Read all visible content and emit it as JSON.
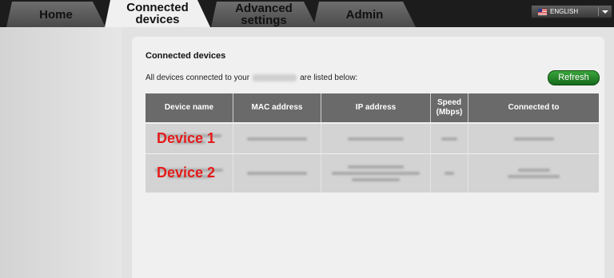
{
  "tabs": [
    {
      "label": "Home",
      "active": false
    },
    {
      "label": "Connected devices",
      "active": true
    },
    {
      "label": "Advanced settings",
      "active": false
    },
    {
      "label": "Admin",
      "active": false
    }
  ],
  "language": {
    "selected": "ENGLISH",
    "flag_icon": "us-flag-icon"
  },
  "page": {
    "title": "Connected devices",
    "description_prefix": "All devices connected to your",
    "description_suffix": "are listed below:",
    "refresh_label": "Refresh"
  },
  "table": {
    "headers": [
      "Device name",
      "MAC address",
      "IP address",
      "Speed (Mbps)",
      "Connected to"
    ],
    "rows": [
      {
        "device_label": "Device 1"
      },
      {
        "device_label": "Device 2"
      }
    ]
  },
  "colors": {
    "accent_green": "#1f8a25",
    "header_gray": "#6a6a6a",
    "annotation_red": "#e41b1b"
  }
}
